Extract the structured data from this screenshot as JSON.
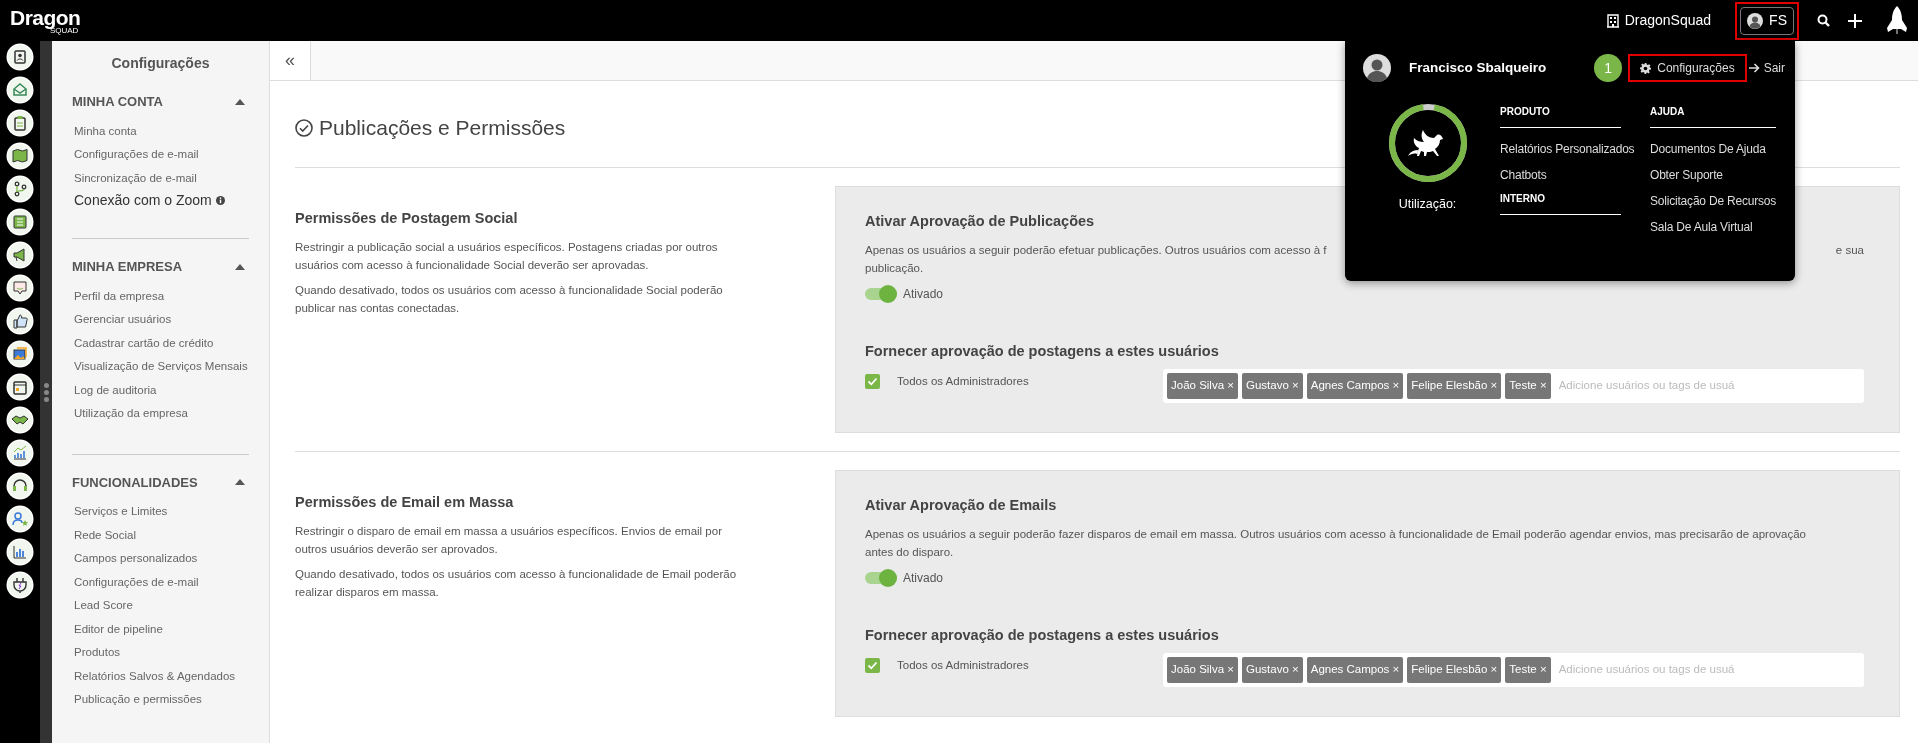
{
  "top_bar": {
    "logo": "Dragon",
    "logo_sub": "SQUAD",
    "company": "DragonSquad",
    "user_initials": "FS",
    "user_highlighted": true
  },
  "sidebar": {
    "title": "Configurações",
    "sections": [
      {
        "title": "MINHA CONTA",
        "expanded": true,
        "items": [
          {
            "label": "Minha conta",
            "kind": "plain"
          },
          {
            "label": "Configurações de e-mail",
            "kind": "plain"
          },
          {
            "label": "Sincronização de e-mail",
            "kind": "plain"
          },
          {
            "label": "Conexão com o Zoom",
            "kind": "info"
          }
        ]
      },
      {
        "title": "MINHA EMPRESA",
        "expanded": true,
        "items": [
          {
            "label": "Perfil da empresa",
            "kind": "plain"
          },
          {
            "label": "Gerenciar usuários",
            "kind": "plain"
          },
          {
            "label": "Cadastrar cartão de crédito",
            "kind": "plain"
          },
          {
            "label": "Visualização de Serviços Mensais",
            "kind": "plain"
          },
          {
            "label": "Log de auditoria",
            "kind": "plain"
          },
          {
            "label": "Utilização da empresa",
            "kind": "plain"
          }
        ]
      },
      {
        "title": "FUNCIONALIDADES",
        "expanded": true,
        "items": [
          {
            "label": "Serviços e Limites",
            "kind": "plain"
          },
          {
            "label": "Rede Social",
            "kind": "plain"
          },
          {
            "label": "Campos personalizados",
            "kind": "plain"
          },
          {
            "label": "Configurações de e-mail",
            "kind": "plain"
          },
          {
            "label": "Lead Score",
            "kind": "plain"
          },
          {
            "label": "Editor de pipeline",
            "kind": "plain"
          },
          {
            "label": "Produtos",
            "kind": "plain"
          },
          {
            "label": "Relatórios Salvos & Agendados",
            "kind": "plain"
          },
          {
            "label": "Publicação e permissões",
            "kind": "plain"
          }
        ]
      }
    ]
  },
  "collapse_button": "«",
  "page": {
    "title": "Publicações e Permissões",
    "sections": [
      {
        "heading": "Permissões de Postagem Social",
        "paragraphs": [
          "Restringir a publicação social a usuários específicos. Postagens criadas por outros usuários com acesso à funcionalidade Social deverão ser aprovadas.",
          "Quando desativado, todos os usuários com acesso à funcionalidade Social poderão publicar nas contas conectadas."
        ],
        "card": {
          "title": "Ativar Aprovação de Publicações",
          "description_lines": [
            [
              "Apenas os usuários a seguir poderão efetuar publicações. Outros usuários com acesso à f",
              "e sua"
            ],
            [
              "publicação."
            ]
          ],
          "toggle": {
            "on": true,
            "label": "Ativado"
          },
          "approvers_title": "Fornecer aprovação de postagens a estes usuários",
          "checkbox": {
            "label": "Todos os Administradores",
            "checked": true
          },
          "tags": [
            "João Silva",
            "Gustavo",
            "Agnes Campos",
            "Felipe Elesbão",
            "Teste"
          ],
          "tag_remove": "×",
          "placeholder": "Adicione usuários ou tags de usuá"
        }
      },
      {
        "heading": "Permissões de Email em Massa",
        "paragraphs": [
          "Restringir o disparo de email em massa a usuários específicos. Envios de email por outros usuários deverão ser aprovados.",
          "Quando desativado, todos os usuários com acesso à funcionalidade de Email poderão realizar disparos em massa."
        ],
        "card": {
          "title": "Ativar Aprovação de Emails",
          "description_lines": [
            [
              "Apenas os usuários a seguir poderão fazer disparos de email em massa. Outros usuários com acesso à funcionalidade de Email poderão agendar envios, mas precisarão de aprovação"
            ],
            [
              "antes do disparo."
            ]
          ],
          "toggle": {
            "on": true,
            "label": "Ativado"
          },
          "approvers_title": "Fornecer aprovação de postagens a estes usuários",
          "checkbox": {
            "label": "Todos os Administradores",
            "checked": true
          },
          "tags": [
            "João Silva",
            "Gustavo",
            "Agnes Campos",
            "Felipe Elesbão",
            "Teste"
          ],
          "tag_remove": "×",
          "placeholder": "Adicione usuários ou tags de usuá"
        }
      }
    ]
  },
  "user_menu": {
    "name": "Francisco Sbalqueiro",
    "step_badge": "1",
    "settings_link": {
      "label": "Configurações",
      "highlighted": true
    },
    "logout_link": "Sair",
    "usage": {
      "label": "Utilização:",
      "level": 0.95
    },
    "columns": [
      [
        {
          "title": "PRODUTO",
          "items": [
            "Relatórios Personalizados",
            "Chatbots"
          ]
        },
        {
          "title": "INTERNO"
        }
      ],
      [
        {
          "title": "AJUDA",
          "items": [
            "Documentos De Ajuda",
            "Obter Suporte",
            "Solicitação De Recursos",
            "Sala De Aula Virtual"
          ]
        }
      ]
    ]
  }
}
